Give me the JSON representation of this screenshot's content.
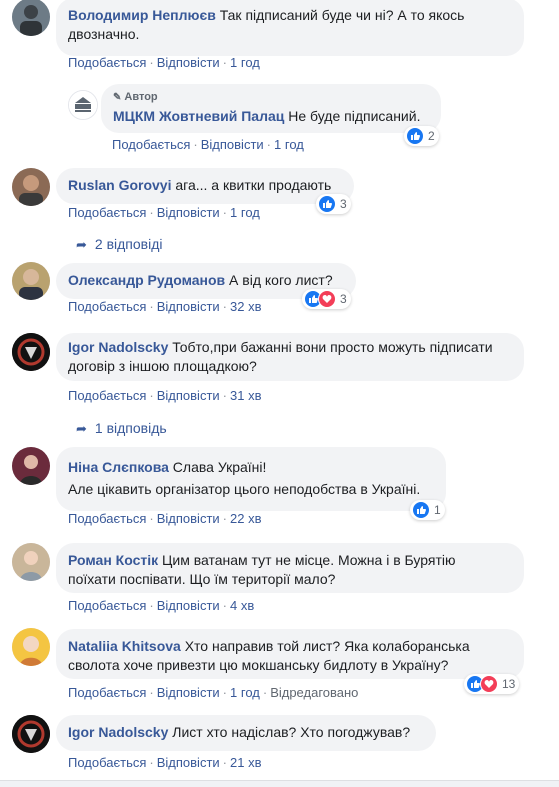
{
  "actions": {
    "like": "Подобається",
    "reply": "Відповісти",
    "sep": "·"
  },
  "colors": {
    "link": "#385898",
    "bubble": "#f2f3f5",
    "like": "#1877f2",
    "love": "#f33e58"
  },
  "comments": [
    {
      "name": "Володимир Неплюєв",
      "text": "Так підписаний буде чи ні? А то якось",
      "text2": "двозначно.",
      "time": "1 год"
    },
    {
      "author_tag": "Автор",
      "name": "МЦКМ Жовтневий Палац",
      "text": "Не буде підписаний.",
      "time": "1 год",
      "reactions": "2"
    },
    {
      "name": "Ruslan Gorovyi",
      "text": "ага... а квитки продають",
      "time": "1 год",
      "reactions": "3",
      "replies": "2 відповіді"
    },
    {
      "name": "Олександр Рудоманов",
      "text": "А від кого лист?",
      "time": "32 хв",
      "reactions": "3"
    },
    {
      "name": "Igor Nadolscky",
      "text": "Тобто,при бажанні вони просто можуть підписати",
      "text2": "договір з іншою площадкою?",
      "time": "31 хв",
      "replies": "1 відповідь"
    },
    {
      "name": "Ніна Слєпкова",
      "text": "Слава Україні!",
      "text2": "Але цікавить організатор цього неподобства в Україні.",
      "time": "22 хв",
      "reactions": "1"
    },
    {
      "name": "Роман Костік",
      "text": "Цим ватанам тут не місце. Можна і в Бурятію",
      "text2": "поїхати поспівати. Що їм території мало?",
      "time": "4 хв"
    },
    {
      "name": "Nataliia Khitsova",
      "text": "Хто направив той лист? Яка колаборанська",
      "text2": "сволота хоче привезти цю мокшанську бидлоту в Україну?",
      "time": "1 год",
      "edited": "Відредаговано",
      "reactions": "13"
    },
    {
      "name": "Igor Nadolscky",
      "text": "Лист хто надіслав? Хто погоджував?",
      "time": "21 хв"
    }
  ]
}
